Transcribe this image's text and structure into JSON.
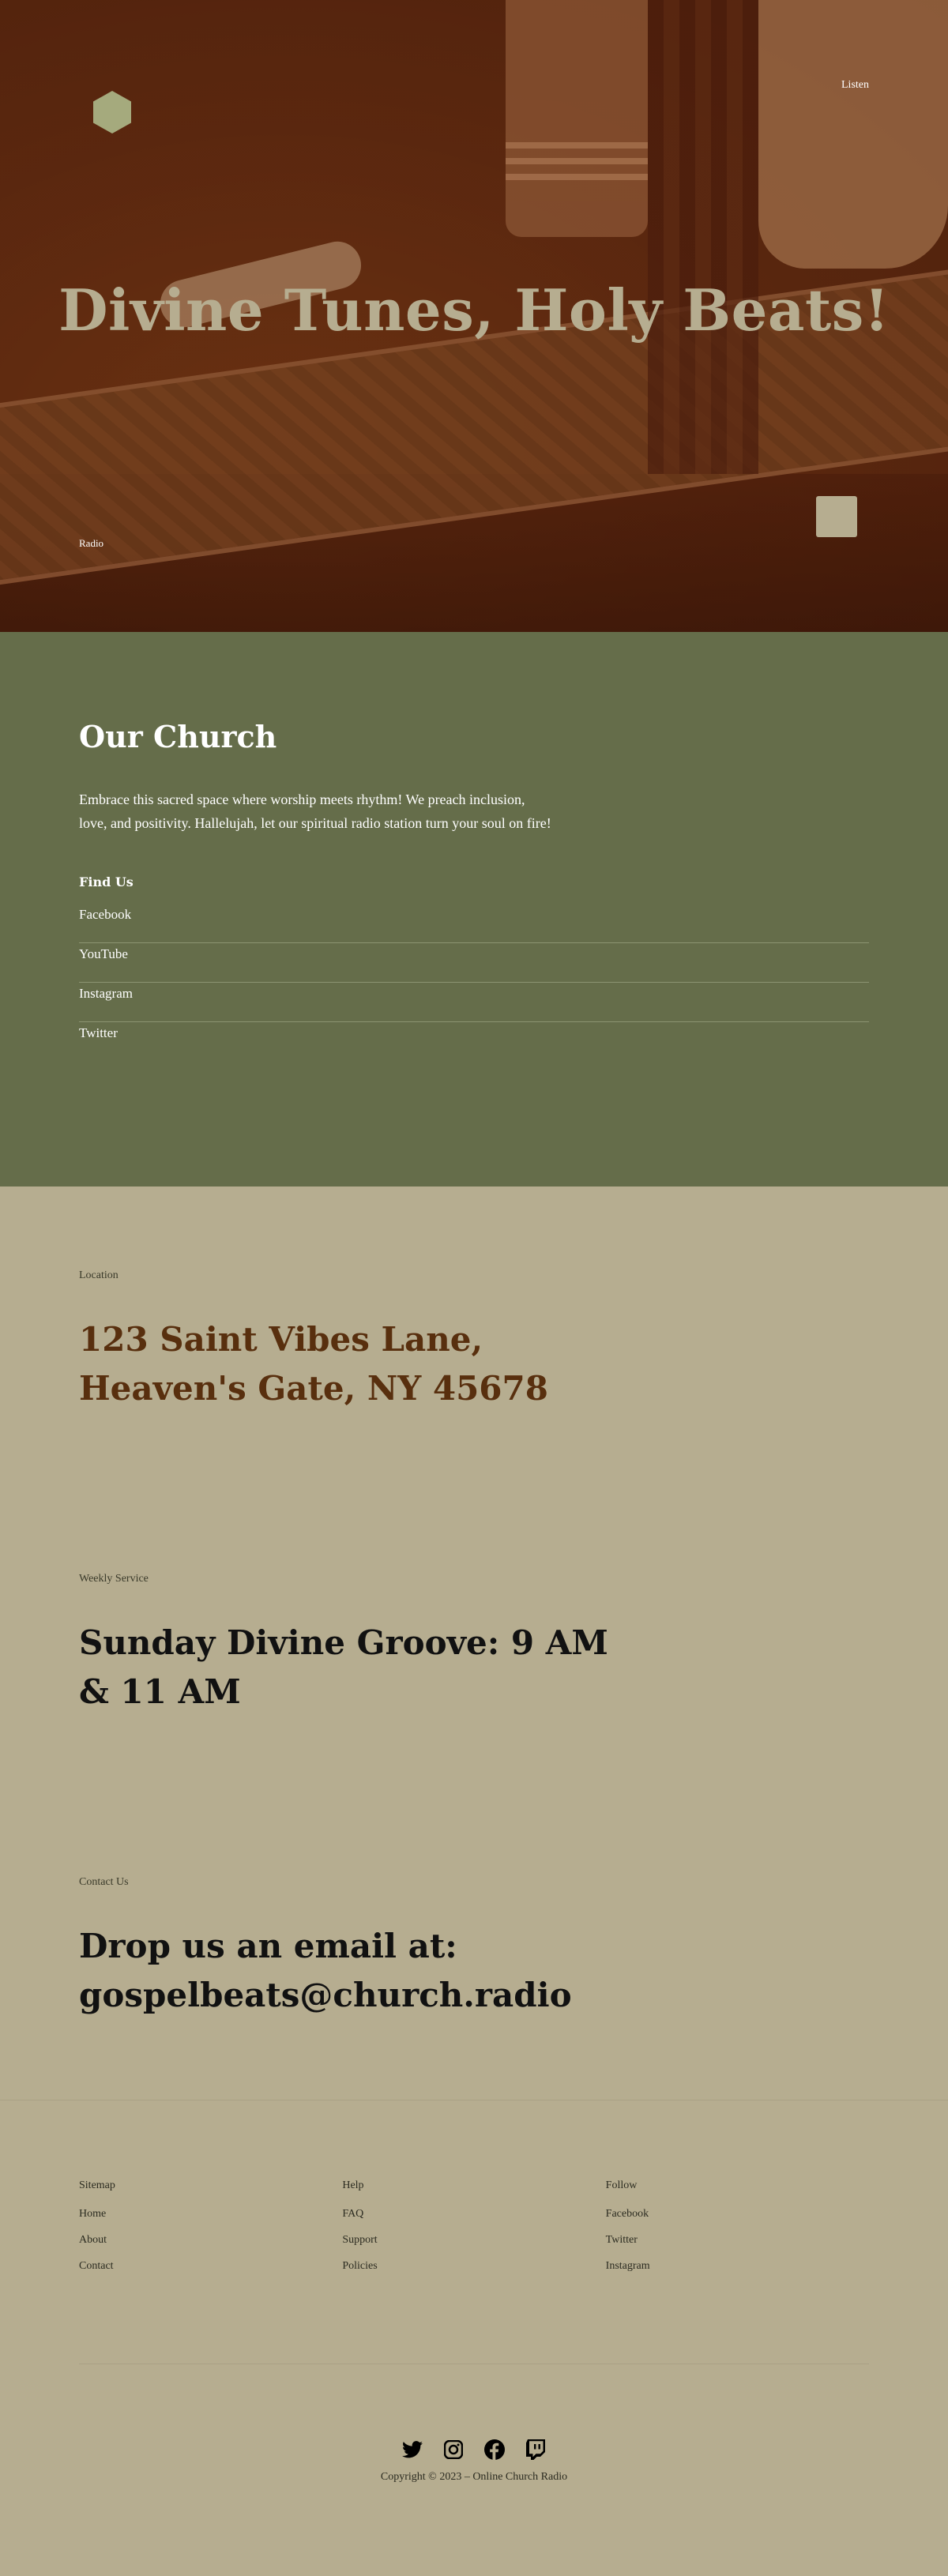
{
  "header": {
    "nav_listen": "Listen"
  },
  "hero": {
    "title": "Divine Tunes, Holy Beats!",
    "radio_label": "Radio"
  },
  "church": {
    "heading": "Our Church",
    "description": "Embrace this sacred space where worship meets rhythm! We preach inclusion, love, and positivity. Hallelujah, let our spiritual radio station turn your soul on fire!",
    "find_us_label": "Find Us",
    "links": [
      "Facebook",
      "YouTube",
      "Instagram",
      "Twitter"
    ]
  },
  "location": {
    "label": "Location",
    "text": "123 Saint Vibes Lane, Heaven's Gate, NY 45678"
  },
  "service": {
    "label": "Weekly Service",
    "text": "Sunday Divine Groove: 9 AM & 11 AM"
  },
  "contact": {
    "label": "Contact Us",
    "text": "Drop us an email at: gospelbeats@church.radio"
  },
  "footer": {
    "columns": [
      {
        "heading": "Sitemap",
        "items": [
          "Home",
          "About",
          "Contact"
        ]
      },
      {
        "heading": "Help",
        "items": [
          "FAQ",
          "Support",
          "Policies"
        ]
      },
      {
        "heading": "Follow",
        "items": [
          "Facebook",
          "Twitter",
          "Instagram"
        ]
      }
    ],
    "social_icons": [
      "twitter-icon",
      "instagram-icon",
      "facebook-icon",
      "twitch-icon"
    ],
    "copyright": "Copyright © 2023 – Online Church Radio"
  },
  "colors": {
    "hero_overlay": "#682d0e",
    "church_bg": "#656d4a",
    "page_bg": "#b6ad90",
    "accent_brown": "#582f0e",
    "logo": "#a5aa7d"
  }
}
